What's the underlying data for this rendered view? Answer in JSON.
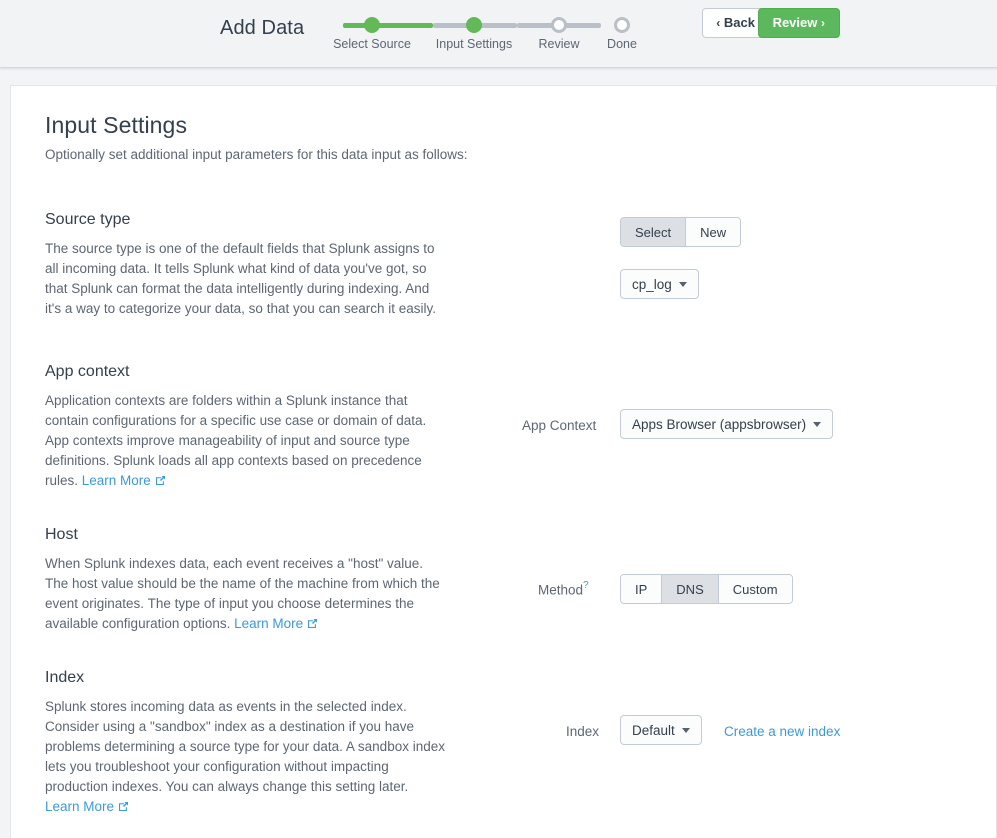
{
  "header": {
    "title": "Add Data",
    "back_label": "Back",
    "back_chevron": "‹",
    "review_label": "Review",
    "review_chevron": "›",
    "accent_green": "#5cb85c",
    "link_blue": "#3c9ad4",
    "steps": [
      {
        "label": "Select Source",
        "state": "complete"
      },
      {
        "label": "Input Settings",
        "state": "complete"
      },
      {
        "label": "Review",
        "state": "pending"
      },
      {
        "label": "Done",
        "state": "pending"
      }
    ]
  },
  "page": {
    "title": "Input Settings",
    "subtitle": "Optionally set additional input parameters for this data input as follows:"
  },
  "sections": {
    "source_type": {
      "title": "Source type",
      "description": "The source type is one of the default fields that Splunk assigns to all incoming data. It tells Splunk what kind of data you've got, so that Splunk can format the data intelligently during indexing. And it's a way to categorize your data, so that you can search it easily.",
      "mode_buttons": [
        {
          "label": "Select",
          "active": true
        },
        {
          "label": "New",
          "active": false
        }
      ],
      "sourcetype_value": "cp_log"
    },
    "app_context": {
      "title": "App context",
      "description": "Application contexts are folders within a Splunk instance that contain configurations for a specific use case or domain of data. App contexts improve manageability of input and source type definitions. Splunk loads all app contexts based on precedence rules. ",
      "learn_more": "Learn More",
      "field_label": "App Context",
      "field_value": "Apps Browser (appsbrowser)"
    },
    "host": {
      "title": "Host",
      "description": "When Splunk indexes data, each event receives a \"host\" value. The host value should be the name of the machine from which the event originates. The type of input you choose determines the available configuration options. ",
      "learn_more": "Learn More",
      "field_label": "Method",
      "help_marker": "?",
      "method_buttons": [
        {
          "label": "IP",
          "active": false
        },
        {
          "label": "DNS",
          "active": true
        },
        {
          "label": "Custom",
          "active": false
        }
      ]
    },
    "index": {
      "title": "Index",
      "description": "Splunk stores incoming data as events in the selected index. Consider using a \"sandbox\" index as a destination if you have problems determining a source type for your data. A sandbox index lets you troubleshoot your configuration without impacting production indexes. You can always change this setting later.",
      "learn_more": "Learn More",
      "field_label": "Index",
      "field_value": "Default",
      "create_link": "Create a new index"
    }
  }
}
